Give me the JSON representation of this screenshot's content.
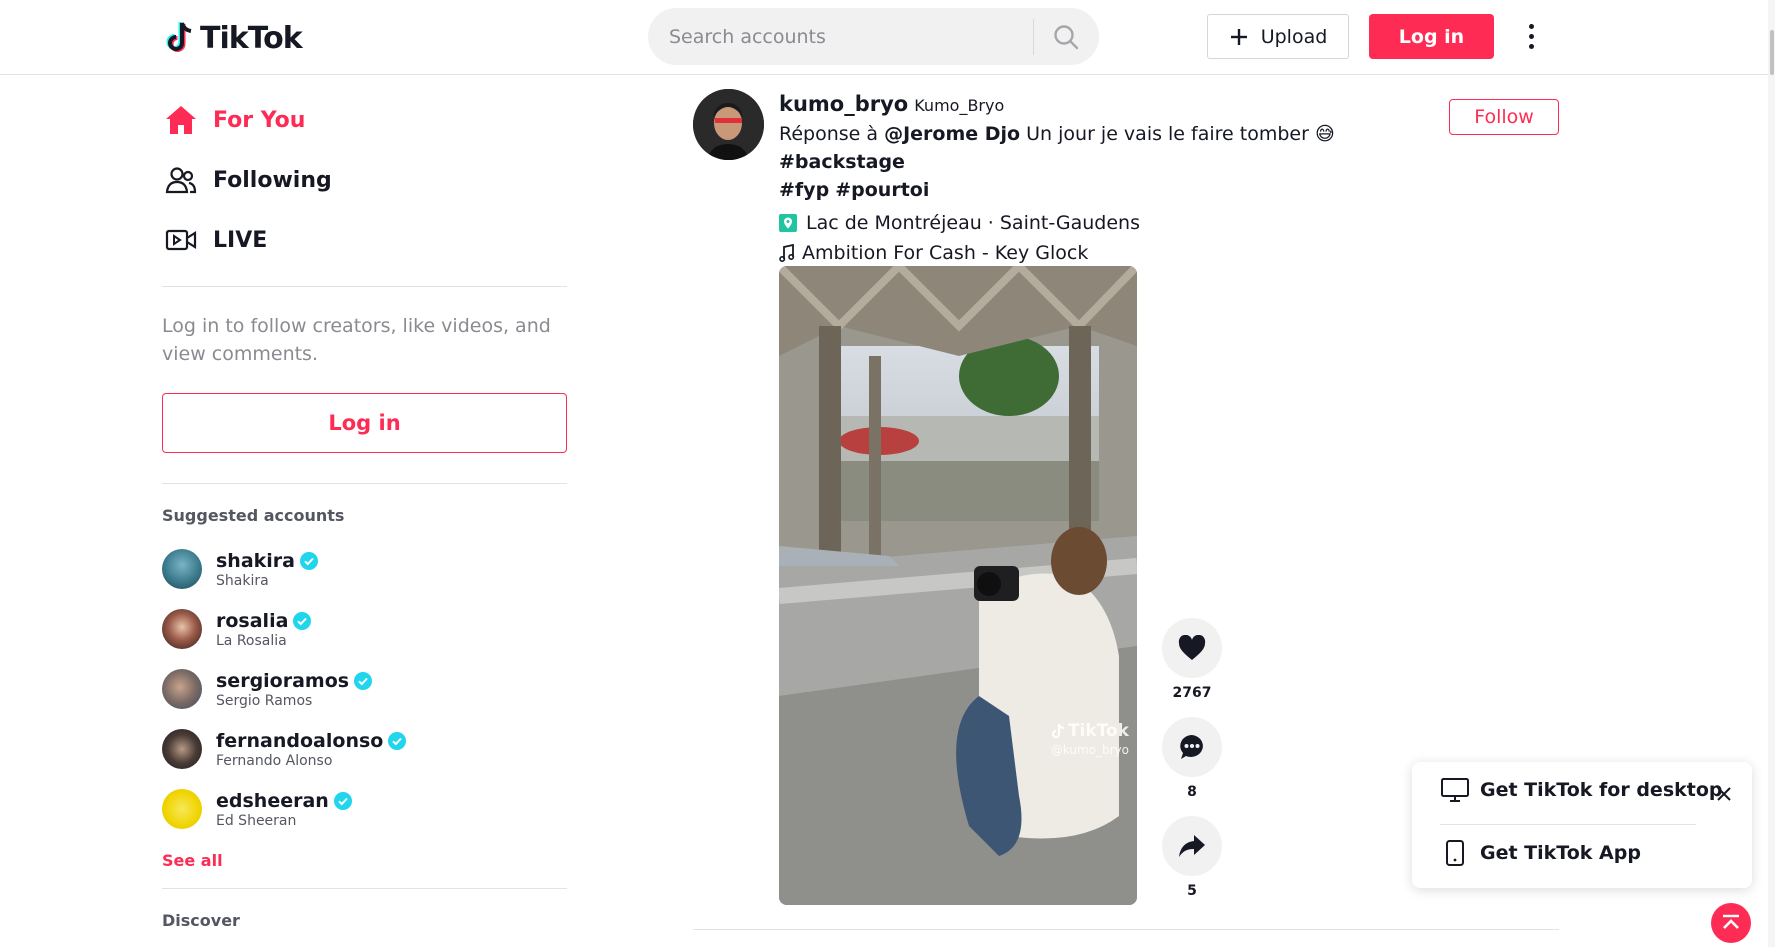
{
  "header": {
    "logo_text": "TikTok",
    "search_placeholder": "Search accounts",
    "upload_label": "Upload",
    "login_label": "Log in"
  },
  "sidebar": {
    "nav": [
      {
        "label": "For You",
        "icon": "home-icon",
        "active": true
      },
      {
        "label": "Following",
        "icon": "users-icon",
        "active": false
      },
      {
        "label": "LIVE",
        "icon": "live-video-icon",
        "active": false
      }
    ],
    "login_prompt": "Log in to follow creators, like videos, and view comments.",
    "login_label": "Log in",
    "suggested_title": "Suggested accounts",
    "accounts": [
      {
        "username": "shakira",
        "nickname": "Shakira",
        "verified": true
      },
      {
        "username": "rosalia",
        "nickname": "La Rosalia",
        "verified": true
      },
      {
        "username": "sergioramos",
        "nickname": "Sergio Ramos",
        "verified": true
      },
      {
        "username": "fernandoalonso",
        "nickname": "Fernando Alonso",
        "verified": true
      },
      {
        "username": "edsheeran",
        "nickname": "Ed Sheeran",
        "verified": true
      }
    ],
    "see_all": "See all",
    "discover": "Discover"
  },
  "post": {
    "username": "kumo_bryo",
    "nickname": "Kumo_Bryo",
    "desc_prefix": "Réponse à ",
    "mention": "@Jerome Djo",
    "desc_text": " Un jour je vais le faire tomber ",
    "emoji": "😅",
    "hashtags": [
      "#backstage",
      "#fyp",
      "#pourtoi"
    ],
    "location": "Lac de Montréjeau · Saint-Gaudens",
    "music": "Ambition For Cash - Key Glock",
    "follow_label": "Follow",
    "watermark_logo": "TikTok",
    "watermark_user": "@kumo_bryo",
    "likes": "2767",
    "comments": "8",
    "shares": "5"
  },
  "get_app": {
    "desktop": "Get TikTok for desktop",
    "app": "Get TikTok App"
  },
  "colors": {
    "brand": "#fe2c55",
    "verified": "#20d5ec",
    "location": "#20c4a0"
  }
}
